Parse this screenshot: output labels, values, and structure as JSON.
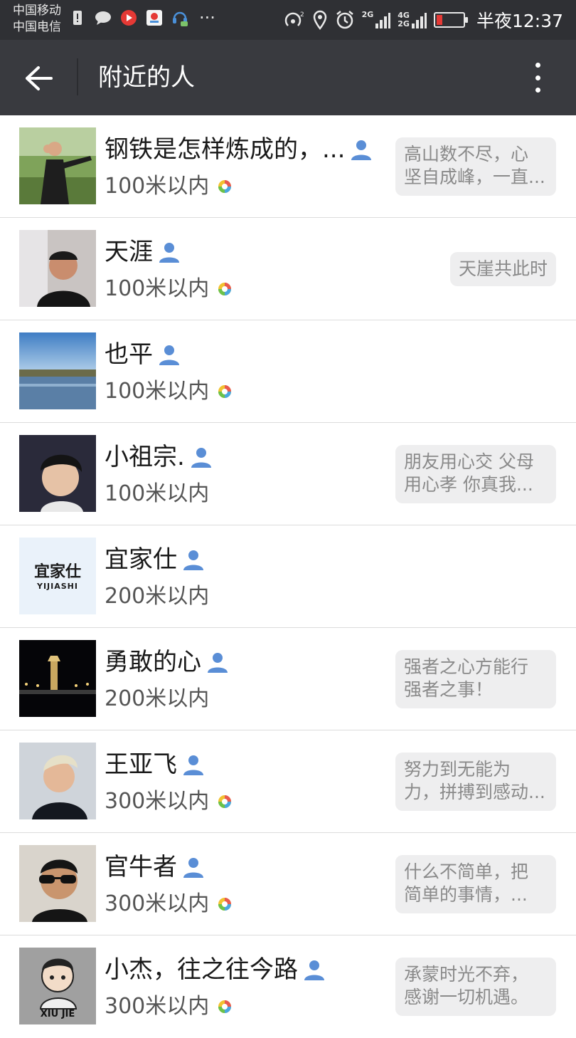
{
  "status_bar": {
    "carrier_1": "中国移动",
    "carrier_2": "中国电信",
    "more": "···",
    "net_1": "2G",
    "net_2": "4G",
    "net_3": "2G",
    "time": "半夜12:37"
  },
  "app_bar": {
    "title": "附近的人"
  },
  "people": [
    {
      "name": "钢铁是怎样炼成的，...",
      "distance": "100米以内",
      "has_moments": true,
      "signature": [
        "高山数不尽，心",
        "坚自成峰，一直..."
      ]
    },
    {
      "name": "天涯",
      "distance": "100米以内",
      "has_moments": true,
      "signature": [
        "天崖共此时"
      ]
    },
    {
      "name": "也平",
      "distance": "100米以内",
      "has_moments": true,
      "signature": []
    },
    {
      "name": "小祖宗.",
      "distance": "100米以内",
      "has_moments": false,
      "signature": [
        "朋友用心交  父母",
        "用心孝   你真我..."
      ]
    },
    {
      "name": "宜家仕",
      "distance": "200米以内",
      "has_moments": false,
      "signature": [],
      "avatar_text": [
        "宜家仕",
        "YIJIASHI"
      ]
    },
    {
      "name": "勇敢的心",
      "distance": "200米以内",
      "has_moments": false,
      "signature": [
        "强者之心方能行",
        "强者之事！"
      ]
    },
    {
      "name": "王亚飞",
      "distance": "300米以内",
      "has_moments": true,
      "signature": [
        "努力到无能为",
        "力，拼搏到感动..."
      ]
    },
    {
      "name": "官牛者",
      "distance": "300米以内",
      "has_moments": true,
      "signature": [
        "什么不简单，把",
        "简单的事情，..."
      ]
    },
    {
      "name": "小杰，往之往今路",
      "distance": "300米以内",
      "has_moments": true,
      "signature": [
        "承蒙时光不弃，",
        "感谢一切机遇。"
      ],
      "avatar_text": [
        "XIU JIE"
      ]
    }
  ],
  "colors": {
    "status_bar_bg": "#2f3034",
    "app_bar_bg": "#393a3f",
    "user_icon": "#5a8ed6",
    "signature_bg": "#eeeeef"
  }
}
